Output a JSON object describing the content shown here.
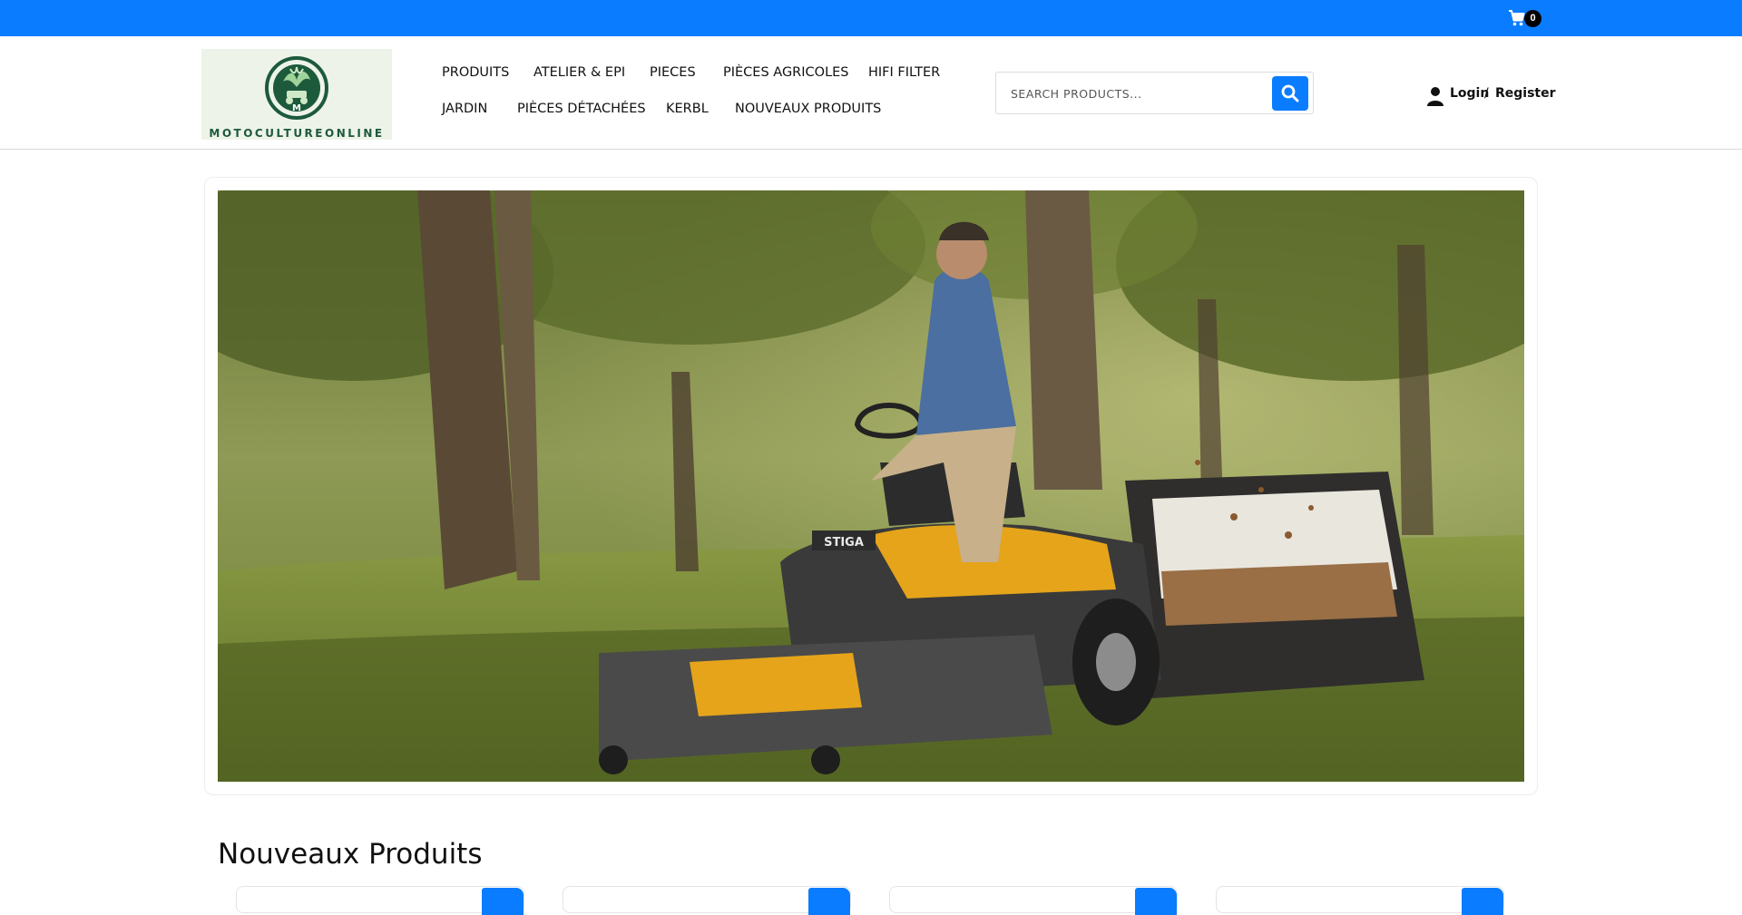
{
  "topbar": {
    "accent_color": "#0a7cff",
    "cart_icon": "shopping-cart-icon",
    "cart_count": "0"
  },
  "logo": {
    "text": "MOTOCULTUREONLINE",
    "letter": "M",
    "color": "#1d5a3b"
  },
  "nav": {
    "row1": [
      "PRODUITS",
      "ATELIER & EPI",
      "PIECES",
      "PIÈCES AGRICOLES",
      "HIFI FILTER"
    ],
    "row2": [
      "JARDIN",
      "PIÈCES DÉTACHÉES",
      "KERBL",
      "NOUVEAUX PRODUITS"
    ]
  },
  "search": {
    "placeholder": "SEARCH PRODUCTS...",
    "button_icon": "search-icon"
  },
  "account": {
    "icon": "user-icon",
    "login_label": "Login",
    "separator": "/",
    "register_label": "Register"
  },
  "hero": {
    "brand_mark": "STIGA"
  },
  "section": {
    "title": "Nouveaux Produits"
  }
}
